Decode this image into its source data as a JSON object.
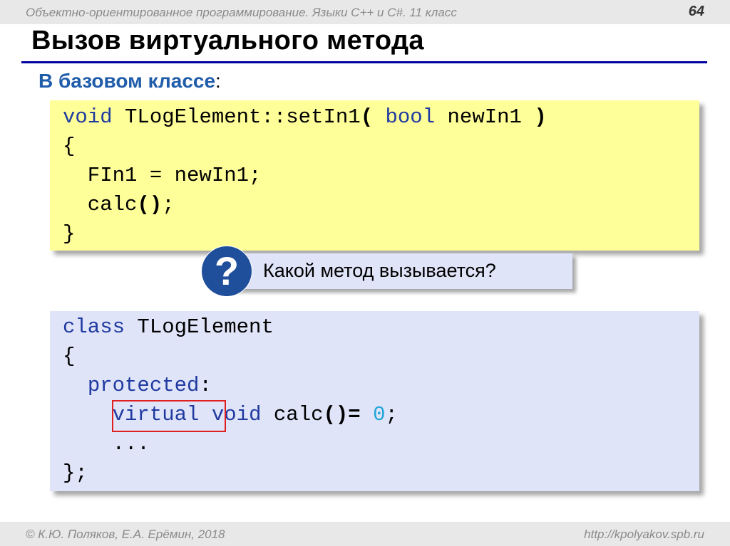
{
  "header": {
    "course": "Объектно-ориентированное программирование. Языки С++ и С#. 11 класс",
    "slide_number": "64"
  },
  "title": "Вызов виртуального метода",
  "subtitle": {
    "text": "В базовом классе",
    "colon": ":"
  },
  "code_block_1": {
    "line1": {
      "kw_void": "void",
      "name": " TLogElement::setIn1",
      "paren_open": "(",
      "kw_bool": " bool",
      "param": " newIn1 ",
      "paren_close": ")"
    },
    "line2": "{",
    "line3": "  FIn1 = newIn1;",
    "line4": {
      "call": "  calc",
      "parens": "()",
      "semi": ";"
    },
    "line5": "}"
  },
  "question": {
    "icon_symbol": "?",
    "text": "Какой метод вызывается?"
  },
  "code_block_2": {
    "line1": {
      "kw_class": "class",
      "name": " TLogElement"
    },
    "line2": "{",
    "line3": {
      "indent": "  ",
      "kw_protected": "protected",
      "colon": ":"
    },
    "line4": {
      "indent": "    ",
      "kw_virtual": "virtual",
      "space": " ",
      "kw_void": "void",
      "name": " calc",
      "parens_eq": "()=",
      "space2": " ",
      "zero": "0",
      "semi": ";"
    },
    "line5": "    ...",
    "line6": "};"
  },
  "footer": {
    "authors": "© К.Ю. Поляков, Е.А. Ерёмин, 2018",
    "url": "http://kpolyakov.spb.ru"
  },
  "colors": {
    "title_underline": "#0000a0",
    "subtitle": "#1f5caa",
    "code1_bg": "#ffff99",
    "code2_bg": "#e0e4f8",
    "keyword": "#1f3aa0",
    "number": "#20a6d8",
    "highlight_box": "#e02020",
    "question_circle": "#1f4e9a"
  }
}
